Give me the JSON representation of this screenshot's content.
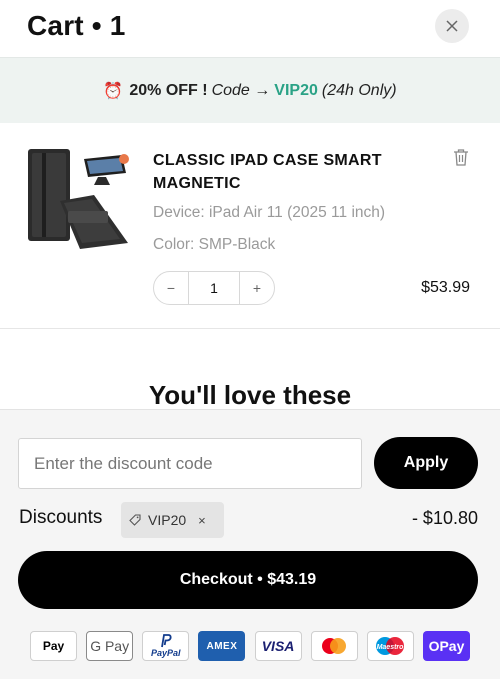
{
  "header": {
    "title": "Cart • 1",
    "close_label": "×"
  },
  "promo": {
    "icon": "⏰",
    "offer": "20% OFF !",
    "code_label": "Code →",
    "code": "VIP20",
    "duration": "(24h Only)",
    "code_color": "#2aa286"
  },
  "item": {
    "name": "CLASSIC IPAD CASE SMART MAGNETIC",
    "device": "Device: iPad Air 11 (2025 11 inch)",
    "color": "Color: SMP-Black",
    "quantity": "1",
    "minus": "−",
    "plus": "+",
    "price": "$53.99"
  },
  "recommendations": {
    "heading": "You'll love these"
  },
  "discount": {
    "placeholder": "Enter the discount code",
    "apply_label": "Apply",
    "label": "Discounts",
    "applied_code": "VIP20",
    "remove": "×",
    "amount": "- $10.80"
  },
  "checkout": {
    "label": "Checkout • $43.19"
  },
  "payments": [
    {
      "name": "apple-pay-icon",
      "text": " Pay"
    },
    {
      "name": "google-pay-icon",
      "text": "G Pay"
    },
    {
      "name": "paypal-icon",
      "text": "PayPal"
    },
    {
      "name": "amex-icon",
      "text": "AMEX"
    },
    {
      "name": "visa-icon",
      "text": "VISA"
    },
    {
      "name": "mastercard-icon",
      "text": ""
    },
    {
      "name": "maestro-icon",
      "text": "Maestro"
    },
    {
      "name": "opay-icon",
      "text": "OPay"
    }
  ],
  "colors": {
    "accent": "#2aa286",
    "button": "#000000",
    "banner_bg": "#eef3f1",
    "footer_bg": "#f5f5f5"
  }
}
